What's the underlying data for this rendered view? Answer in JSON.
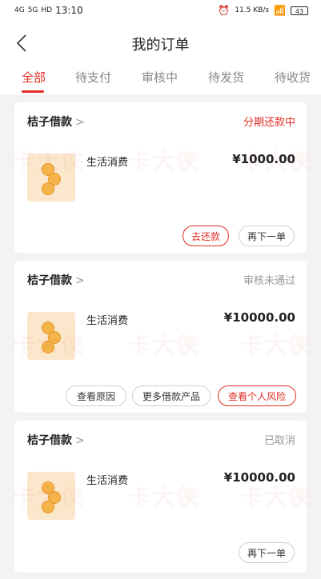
{
  "status_bar": {
    "network": "4G",
    "network2": "5G",
    "hd": "HD",
    "time": "13:10",
    "speed": "11.5 KB/s",
    "battery": "43"
  },
  "header": {
    "back_icon": "chevron-left-icon",
    "title": "我的订单"
  },
  "tabs": [
    {
      "label": "全部",
      "active": true
    },
    {
      "label": "待支付",
      "active": false
    },
    {
      "label": "审核中",
      "active": false
    },
    {
      "label": "待发货",
      "active": false
    },
    {
      "label": "待收货",
      "active": false
    }
  ],
  "orders": [
    {
      "shop": "桔子借款",
      "status": "分期还款中",
      "status_color": "#e02e24",
      "item": "生活消费",
      "price": "¥1000.00",
      "buttons": [
        "去还款",
        "再下一单"
      ]
    },
    {
      "shop": "桔子借款",
      "status": "审核未通过",
      "status_color": "#999999",
      "item": "生活消费",
      "price": "¥10000.00",
      "buttons": [
        "查看原因",
        "更多借款产品",
        "查看个人风险"
      ]
    },
    {
      "shop": "桔子借款",
      "status": "已取消",
      "status_color": "#999999",
      "item": "生活消费",
      "price": "¥10000.00",
      "buttons": [
        "再下一单"
      ]
    }
  ],
  "watermark": "卡大侠",
  "accent_color": "#e02e24"
}
